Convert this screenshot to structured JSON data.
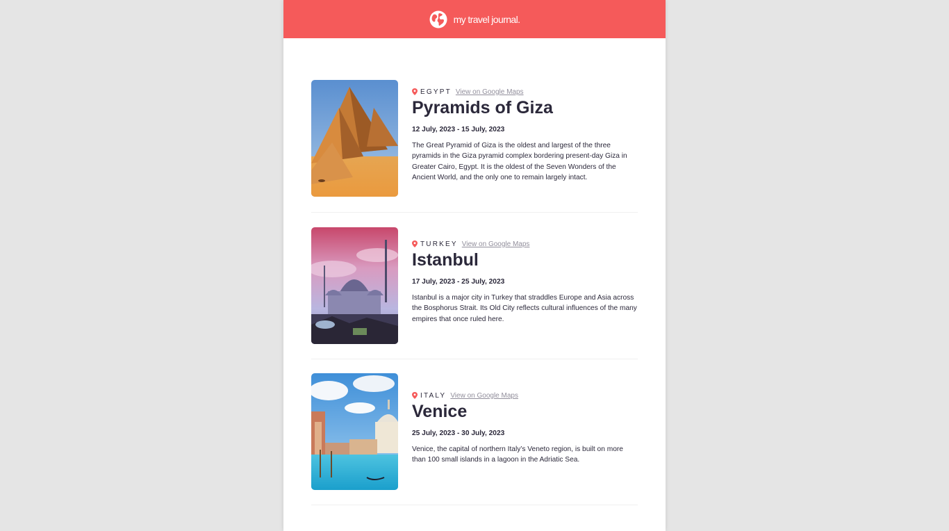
{
  "header": {
    "title": "my travel journal.",
    "icon": "globe-icon",
    "background": "#f55a5a"
  },
  "entries": [
    {
      "country": "EGYPT",
      "maps_link": "View on Google Maps",
      "place": "Pyramids of Giza",
      "dates": "12 July, 2023 - 15 July, 2023",
      "description": "The Great Pyramid of Giza is the oldest and largest of the three pyramids in the Giza pyramid complex bordering present-day Giza in Greater Cairo, Egypt. It is the oldest of the Seven Wonders of the Ancient World, and the only one to remain largely intact.",
      "image": "pyramids-photo"
    },
    {
      "country": "TURKEY",
      "maps_link": "View on Google Maps",
      "place": "Istanbul",
      "dates": "17 July, 2023 - 25 July, 2023",
      "description": "Istanbul is a major city in Turkey that straddles Europe and Asia across the Bosphorus Strait. Its Old City reflects cultural influences of the many empires that once ruled here.",
      "image": "istanbul-mosque-photo"
    },
    {
      "country": "ITALY",
      "maps_link": "View on Google Maps",
      "place": "Venice",
      "dates": "25 July, 2023 - 30 July, 2023",
      "description": "Venice, the capital of northern Italy’s Veneto region, is built on more than 100 small islands in a lagoon in the Adriatic Sea.",
      "image": "venice-canal-photo"
    }
  ],
  "colors": {
    "accent": "#f55a5a",
    "text": "#2b283a",
    "muted": "#918e9b"
  }
}
